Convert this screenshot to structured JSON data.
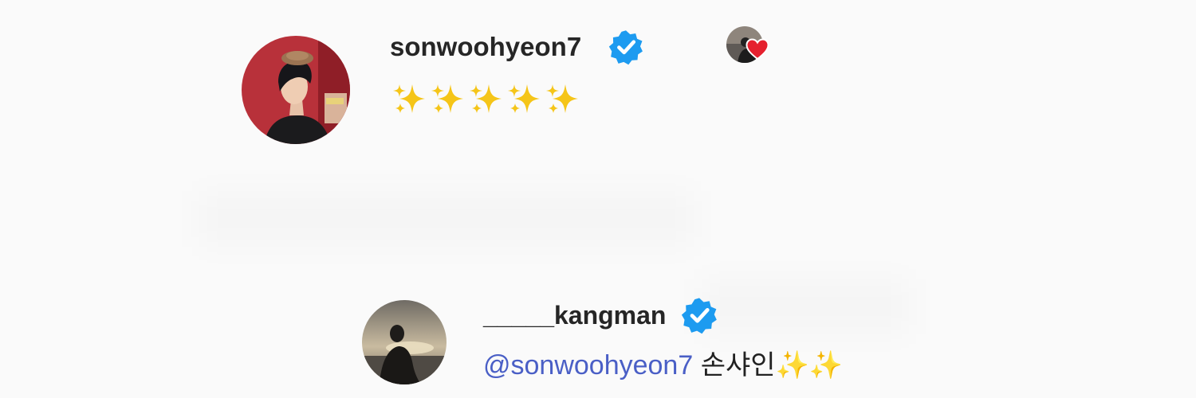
{
  "comments": [
    {
      "username": "sonwoohyeon7",
      "verified": true,
      "text": "✨✨✨✨✨",
      "creator_liked": true
    },
    {
      "username": "_____kangman",
      "verified": true,
      "mention": "@sonwoohyeon7",
      "text": "손샤인✨✨"
    }
  ],
  "colors": {
    "verified_badge": "#1d9bf0",
    "mention": "#4a5fc6",
    "heart": "#e5202e",
    "background": "#fafafa"
  },
  "icons": [
    "verified-badge-icon",
    "sparkles-icon",
    "heart-icon"
  ]
}
